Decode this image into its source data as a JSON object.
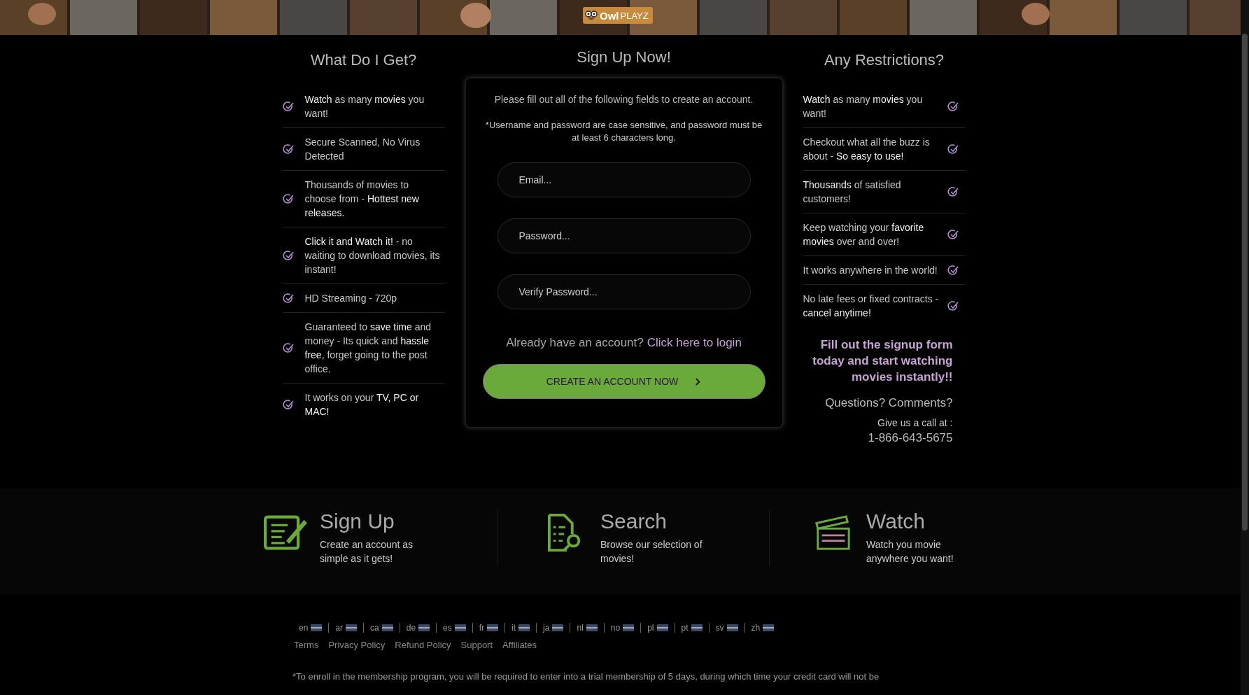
{
  "banner": {
    "kind": "picture",
    "logo": {
      "word1": "Owl",
      "word2": "PLAYZ"
    }
  },
  "benefits": {
    "title": "What Do I Get?",
    "items": [
      {
        "text": "**Watch** as many **movies** you want!"
      },
      {
        "text": "Secure Scanned, No Virus Detected"
      },
      {
        "text": "Thousands of movies to choose from - **Hottest new releases.**"
      },
      {
        "text": "**Click it and Watch it!** - no waiting to download movies, its instant!"
      },
      {
        "text": "HD Streaming - 720p"
      },
      {
        "text": "Guaranteed to **save time** and money - Its quick and **hassle free**, forget going to the post office."
      },
      {
        "text": "It works on your **TV, PC or MAC!**"
      }
    ]
  },
  "signup": {
    "title": "Sign Up Now!",
    "intro": "Please fill out all of the following fields to create an account.",
    "note": "*Username and password are case sensitive, and password must be at least 6 characters long.",
    "fields": [
      {
        "placeholder": "Email..."
      },
      {
        "placeholder": "Password..."
      },
      {
        "placeholder": "Verify Password..."
      }
    ],
    "login_prompt": "Already have an account?",
    "login_link": "Click here to login",
    "submit": "CREATE AN ACCOUNT NOW"
  },
  "restrictions": {
    "title": "Any Restrictions?",
    "items": [
      {
        "text": "**Watch** as many **movies** you want!"
      },
      {
        "text": "Checkout what all the buzz is about - **So easy to use!**"
      },
      {
        "text": "**Thousands** of satisfied customers!"
      },
      {
        "text": "Keep watching your **favorite movies** over and over!"
      },
      {
        "text": "It works anywhere in the world!"
      },
      {
        "text": "No late fees or fixed contracts - **cancel anytime!**"
      }
    ],
    "promo": "Fill out the signup form today and start watching movies instantly!!",
    "contact_title": "Questions? Comments?",
    "call_label": "Give us a call at :",
    "phone": "1-866-643-5675"
  },
  "features": [
    {
      "kind": "signup",
      "title": "Sign Up",
      "text": "Create an account as simple as it gets!"
    },
    {
      "kind": "search",
      "title": "Search",
      "text": "Browse our selection of movies!"
    },
    {
      "kind": "watch",
      "title": "Watch",
      "text": "Watch you movie anywhere you want!"
    }
  ],
  "languages": [
    {
      "code": "en"
    },
    {
      "code": "ar"
    },
    {
      "code": "ca"
    },
    {
      "code": "de"
    },
    {
      "code": "es"
    },
    {
      "code": "fr"
    },
    {
      "code": "it"
    },
    {
      "code": "ja"
    },
    {
      "code": "nl"
    },
    {
      "code": "no"
    },
    {
      "code": "pl"
    },
    {
      "code": "pt"
    },
    {
      "code": "sv"
    },
    {
      "code": "zh"
    }
  ],
  "footer_links": [
    "Terms",
    "Privacy Policy",
    "Refund Policy",
    "Support",
    "Affiliates"
  ],
  "disclaimer": "*To enroll in the membership program, you will be required to enter into a trial membership of 5 days, during which time your credit card will not be"
}
